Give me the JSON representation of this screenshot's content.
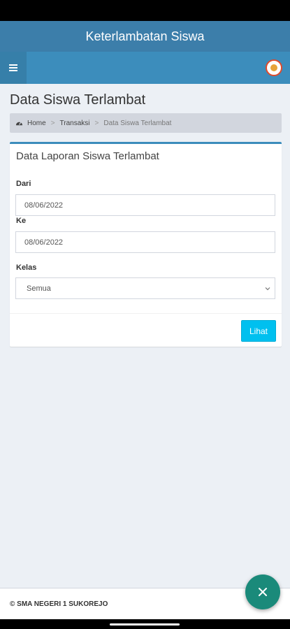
{
  "app_bar": {
    "title": "Keterlambatan Siswa"
  },
  "page": {
    "title": "Data Siswa Terlambat"
  },
  "breadcrumb": {
    "home": "Home",
    "section": "Transaksi",
    "current": "Data Siswa Terlambat"
  },
  "form": {
    "box_title": "Data Laporan Siswa Terlambat",
    "dari_label": "Dari",
    "dari_value": "08/06/2022",
    "ke_label": "Ke",
    "ke_value": "08/06/2022",
    "kelas_label": "Kelas",
    "kelas_value": "Semua",
    "submit_label": "Lihat"
  },
  "footer": {
    "text": "© SMA NEGERI 1 SUKOREJO"
  },
  "colors": {
    "app_bar": "#3c7eaa",
    "navbar": "#3c8dbc",
    "button": "#00c0ef",
    "fab": "#1a8a7a",
    "background": "#ecf0f5"
  },
  "icons": {
    "menu": "hamburger-icon",
    "home": "dashboard-icon",
    "fab": "close-icon",
    "select": "chevron-down-icon"
  }
}
